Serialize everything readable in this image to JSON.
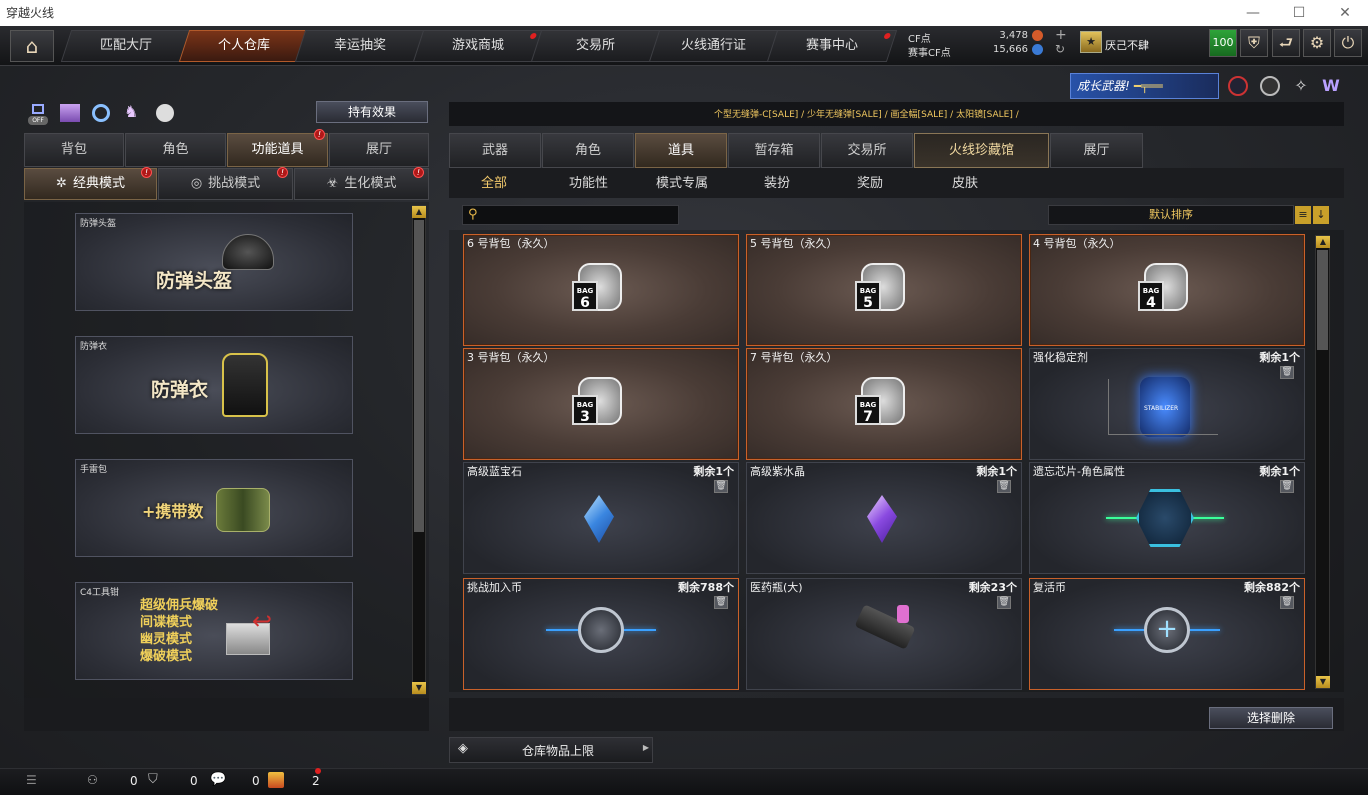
{
  "window": {
    "title": "穿越火线"
  },
  "nav": {
    "tabs": [
      {
        "label": "匹配大厅"
      },
      {
        "label": "个人仓库"
      },
      {
        "label": "幸运抽奖"
      },
      {
        "label": "游戏商城"
      },
      {
        "label": "交易所"
      },
      {
        "label": "火线通行证"
      },
      {
        "label": "赛事中心"
      }
    ],
    "cf_label": "CF点",
    "cf_value": "3,478",
    "match_cf_label": "赛事CF点",
    "match_cf_value": "15,666",
    "username": "厌己不肆",
    "level": "100"
  },
  "banner": {
    "promo": "成长武器!"
  },
  "ticker": "个型无缝弹-C[SALE] / 少年无缝弹[SALE] / 画全幅[SALE] / 太阳镜[SALE] /",
  "left": {
    "off_label": "OFF",
    "hold_effect_button": "持有效果",
    "category_tabs": [
      {
        "label": "背包"
      },
      {
        "label": "角色"
      },
      {
        "label": "功能道具"
      },
      {
        "label": "展厅"
      }
    ],
    "mode_tabs": [
      {
        "label": "经典模式"
      },
      {
        "label": "挑战模式"
      },
      {
        "label": "生化模式"
      }
    ],
    "slots": [
      {
        "title": "防弹头盔",
        "big": "防弹头盔"
      },
      {
        "title": "防弹衣",
        "big": "防弹衣"
      },
      {
        "title": "手雷包",
        "big": "+携带数"
      },
      {
        "title": "C4工具钳",
        "lines": [
          "超级佣兵爆破",
          "间谍模式",
          "幽灵模式",
          "爆破模式"
        ]
      }
    ]
  },
  "right": {
    "tabs": [
      {
        "label": "武器"
      },
      {
        "label": "角色"
      },
      {
        "label": "道具"
      },
      {
        "label": "暂存箱"
      },
      {
        "label": "交易所"
      },
      {
        "label": "火线珍藏馆"
      },
      {
        "label": "展厅"
      }
    ],
    "subtabs": [
      {
        "label": "全部"
      },
      {
        "label": "功能性"
      },
      {
        "label": "模式专属"
      },
      {
        "label": "装扮"
      },
      {
        "label": "奖励"
      },
      {
        "label": "皮肤"
      }
    ],
    "search_placeholder": "",
    "sort_label": "默认排序",
    "items": [
      {
        "name": "6 号背包（永久）",
        "count": "",
        "bag": "6"
      },
      {
        "name": "5 号背包（永久）",
        "count": "",
        "bag": "5"
      },
      {
        "name": "4 号背包（永久）",
        "count": "",
        "bag": "4"
      },
      {
        "name": "3 号背包（永久）",
        "count": "",
        "bag": "3"
      },
      {
        "name": "7 号背包（永久）",
        "count": "",
        "bag": "7"
      },
      {
        "name": "强化稳定剂",
        "count": "剩余1个",
        "icon": "stabilizer-icon",
        "badge": "STABILIZER"
      },
      {
        "name": "高级蓝宝石",
        "count": "剩余1个",
        "icon": "blue-gem-icon"
      },
      {
        "name": "高级紫水晶",
        "count": "剩余1个",
        "icon": "purple-crystal-icon"
      },
      {
        "name": "遗忘芯片-角色属性",
        "count": "剩余1个",
        "icon": "chip-icon"
      },
      {
        "name": "挑战加入币",
        "count": "剩余788个",
        "icon": "challenge-coin-icon"
      },
      {
        "name": "医药瓶(大)",
        "count": "剩余23个",
        "icon": "medkit-gun-icon"
      },
      {
        "name": "复活币",
        "count": "剩余882个",
        "icon": "revive-coin-icon"
      }
    ],
    "bag_text": "BAG",
    "delete_button": "选择删除",
    "storage_limit": "仓库物品上限"
  },
  "status": {
    "count1": "0",
    "count2": "0",
    "count3": "0",
    "gift_count": "2"
  },
  "colors": {
    "accent": "#c9612a",
    "gold": "#f1c86b",
    "alert": "#e02020"
  }
}
